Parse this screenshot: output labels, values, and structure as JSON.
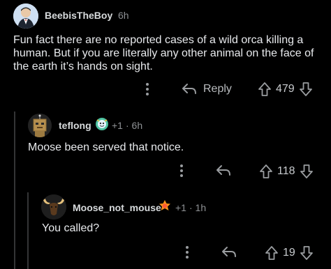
{
  "comments": [
    {
      "username": "BeebisTheBoy",
      "time": "6h",
      "body_lines": [
        "Fun fact there are no reported cases of a wild orca killing a",
        "human. But if you are literally any other animal on the face of",
        "the earth it’s hands on sight."
      ],
      "reply_label": "Reply",
      "votes": "479",
      "avatar_icon": "tuxedo-avatar-icon"
    },
    {
      "username": "teflong",
      "award_count": "+1",
      "time": "· 6h",
      "body": "Moose been served that notice.",
      "votes": "118",
      "avatar_icon": "box-robot-avatar-icon"
    },
    {
      "username": "Moose_not_mouse",
      "award_count": "+1",
      "time": "· 1h",
      "body": "You called?",
      "votes": "19",
      "avatar_icon": "moose-avatar-icon"
    }
  ],
  "colors": {
    "background": "#000000",
    "text": "#e8eaed",
    "meta": "#8e9194",
    "thread_line": "#343536"
  }
}
